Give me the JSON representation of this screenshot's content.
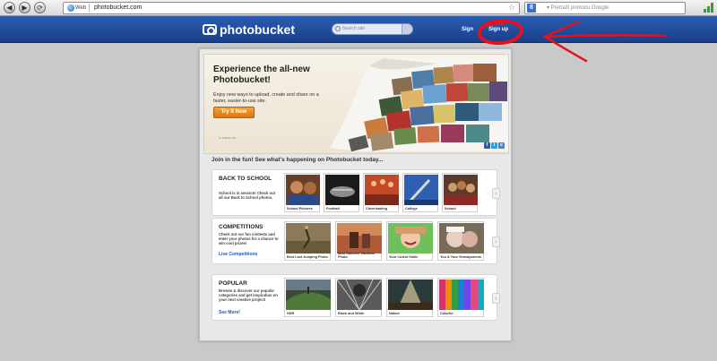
{
  "browser": {
    "back_glyph": "◀",
    "forward_glyph": "▶",
    "reload_glyph": "⟳",
    "url_prefix": "Web",
    "url": "photobucket.com",
    "star_glyph": "☆",
    "search_engine_glyph": "8",
    "search_placeholder": "▾  Pretraži pomoću Google"
  },
  "header": {
    "logo_text": "photobucket",
    "search_placeholder": "Search site",
    "sign_in": "Sign",
    "sign_up": "Sign up",
    "annotation_color": "#e0141e"
  },
  "banner": {
    "title": "Experience the all-new Photobucket!",
    "subtitle": "Enjoy new ways to upload, create and share on a faster, easier-to-use site.",
    "button": "Try It Now",
    "small_text": "••  •••••••  •••",
    "social": [
      "f",
      "t",
      "e"
    ]
  },
  "join_text": "Join in the fun! See what's happening on Photobucket today...",
  "sections": [
    {
      "title": "BACK TO SCHOOL",
      "description": "School is in session! Check out all our Back to School photos.",
      "link": "",
      "thumbs": [
        {
          "caption": "School Pictures"
        },
        {
          "caption": "Football"
        },
        {
          "caption": "Cheerleading"
        },
        {
          "caption": "College"
        },
        {
          "caption": "School"
        }
      ]
    },
    {
      "title": "COMPETITIONS",
      "description": "Check out our fun contests and enter your photos for a chance to win cool prizes!",
      "link": "Live Competitions",
      "thumbs": [
        {
          "caption": "Best Last Jumping Photo"
        },
        {
          "caption": "Best Summer Vacation Photo"
        },
        {
          "caption": "Your Cutest Smile"
        },
        {
          "caption": "You & Your Grandparents"
        }
      ]
    },
    {
      "title": "POPULAR",
      "description": "Browse & discover our popular categories and get inspiration on your next creative project!",
      "link": "See More!",
      "thumbs": [
        {
          "caption": "HDR"
        },
        {
          "caption": "Black and White"
        },
        {
          "caption": "Nature"
        },
        {
          "caption": "Colorful"
        }
      ]
    }
  ],
  "arrow_glyph": "›"
}
